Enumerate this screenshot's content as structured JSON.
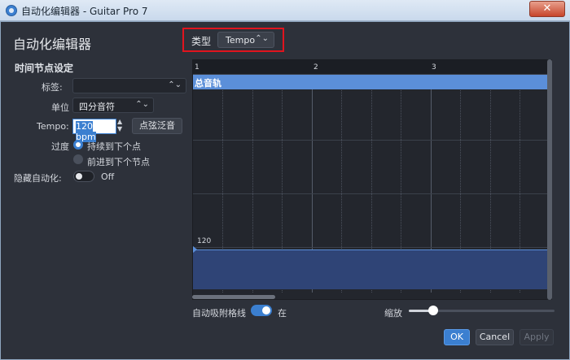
{
  "window": {
    "title": "自动化编辑器 - Guitar Pro 7",
    "close_glyph": "✕"
  },
  "panel": {
    "heading": "自动化编辑器",
    "section": "时间节点设定",
    "label_tag": "标签:",
    "tag_value": "",
    "label_unit": "单位",
    "unit_value": "四分音符",
    "label_tempo": "Tempo:",
    "tempo_value": "120 bpm",
    "dotted_button": "点弦泛音",
    "label_transition": "过度",
    "radio_continue": "持续到下个点",
    "radio_advance": "前进到下个节点",
    "label_hide": "隐藏自动化:",
    "hide_state": "Off"
  },
  "type_selector": {
    "label": "类型",
    "value": "Tempo"
  },
  "editor": {
    "ruler": [
      "1",
      "2",
      "3"
    ],
    "track_name": "总音轨",
    "point_value": "120"
  },
  "bottom": {
    "snap_label": "自动吸附格线",
    "snap_state": "在",
    "zoom_label": "缩放",
    "zoom_level": 0.17
  },
  "buttons": {
    "ok": "OK",
    "cancel": "Cancel",
    "apply": "Apply"
  },
  "colors": {
    "accent": "#3b7fd0",
    "highlight": "#e0141e",
    "track": "#5b8fd9"
  },
  "icons": {
    "app": "guitar-pro-icon",
    "dropdown": "updown-chevron-icon",
    "spinner": "spin-arrows-icon",
    "close": "close-icon",
    "point": "automation-point-icon"
  }
}
